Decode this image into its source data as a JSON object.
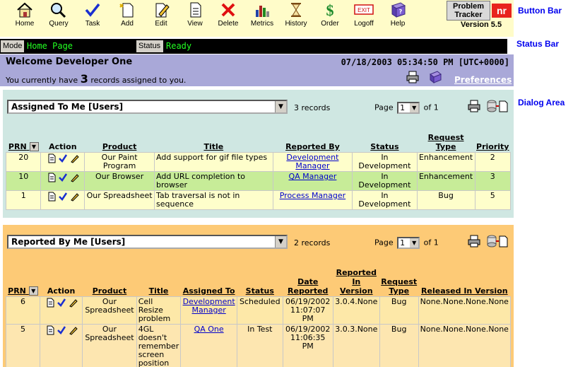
{
  "toolbar": {
    "buttons": [
      {
        "label": "Home",
        "icon": "home-icon"
      },
      {
        "label": "Query",
        "icon": "magnifier-icon"
      },
      {
        "label": "Task",
        "icon": "checkmark-icon"
      },
      {
        "label": "Add",
        "icon": "new-document-icon"
      },
      {
        "label": "Edit",
        "icon": "pencil-icon"
      },
      {
        "label": "View",
        "icon": "document-icon"
      },
      {
        "label": "Delete",
        "icon": "red-x-icon"
      },
      {
        "label": "Metrics",
        "icon": "bar-chart-icon"
      },
      {
        "label": "History",
        "icon": "hourglass-icon"
      },
      {
        "label": "Order",
        "icon": "dollar-icon"
      },
      {
        "label": "Logoff",
        "icon": "exit-sign-icon"
      },
      {
        "label": "Help",
        "icon": "help-book-icon"
      }
    ],
    "logo_line1": "Problem",
    "logo_line2": "Tracker",
    "logo_mark": "nr",
    "version": "Version 5.5",
    "exit_text": "EXIT"
  },
  "side_labels": {
    "button_bar": "Button Bar",
    "status_bar": "Status Bar",
    "dialog_area": "Dialog Area"
  },
  "statusbar": {
    "mode_label": "Mode",
    "mode_value": "Home Page",
    "status_label": "Status",
    "status_value": "Ready"
  },
  "welcome": {
    "title": "Welcome Developer One",
    "datetime": "07/18/2003 05:34:50 PM [UTC+0000]",
    "sub_prefix": "You currently have",
    "record_count": "3",
    "sub_suffix": "records assigned to you.",
    "preferences": "Preferences"
  },
  "assigned": {
    "view": "Assigned To Me [Users]",
    "count": "3 records",
    "page_label": "Page",
    "page_value": "1",
    "page_of": "of 1",
    "columns": [
      "PRN",
      "Action",
      "Product",
      "Title",
      "Reported By",
      "Status",
      "Request Type",
      "Priority"
    ],
    "rows": [
      {
        "prn": "20",
        "product": "Our Paint Program",
        "title": "Add support for gif file types",
        "reported_by": "Development Manager",
        "status": "In Development",
        "type": "Enhancement",
        "priority": "2"
      },
      {
        "prn": "10",
        "product": "Our Browser",
        "title": "Add URL completion to browser",
        "reported_by": "QA Manager",
        "status": "In Development",
        "type": "Enhancement",
        "priority": "3"
      },
      {
        "prn": "1",
        "product": "Our Spreadsheet",
        "title": "Tab traversal is not in sequence",
        "reported_by": "Process Manager",
        "status": "In Development",
        "type": "Bug",
        "priority": "5"
      }
    ]
  },
  "reported": {
    "view": "Reported By Me [Users]",
    "count": "2 records",
    "page_label": "Page",
    "page_value": "1",
    "page_of": "of 1",
    "columns": [
      "PRN",
      "Action",
      "Product",
      "Title",
      "Assigned To",
      "Status",
      "Date Reported",
      "Reported In Version",
      "Request Type",
      "Released In Version"
    ],
    "rows": [
      {
        "prn": "6",
        "product": "Our Spreadsheet",
        "title": "Cell Resize problem",
        "assigned_to": "Development Manager",
        "status": "Scheduled",
        "date": "06/19/2002 11:07:07 PM",
        "reported_version": "3.0.4.None",
        "type": "Bug",
        "released_version": "None.None.None.None"
      },
      {
        "prn": "5",
        "product": "Our Spreadsheet",
        "title": "4GL doesn't remember screen position",
        "assigned_to": "QA One",
        "status": "In Test",
        "date": "06/19/2002 11:06:35 PM",
        "reported_version": "3.0.3.None",
        "type": "Bug",
        "released_version": "None.None.None.None"
      }
    ]
  }
}
